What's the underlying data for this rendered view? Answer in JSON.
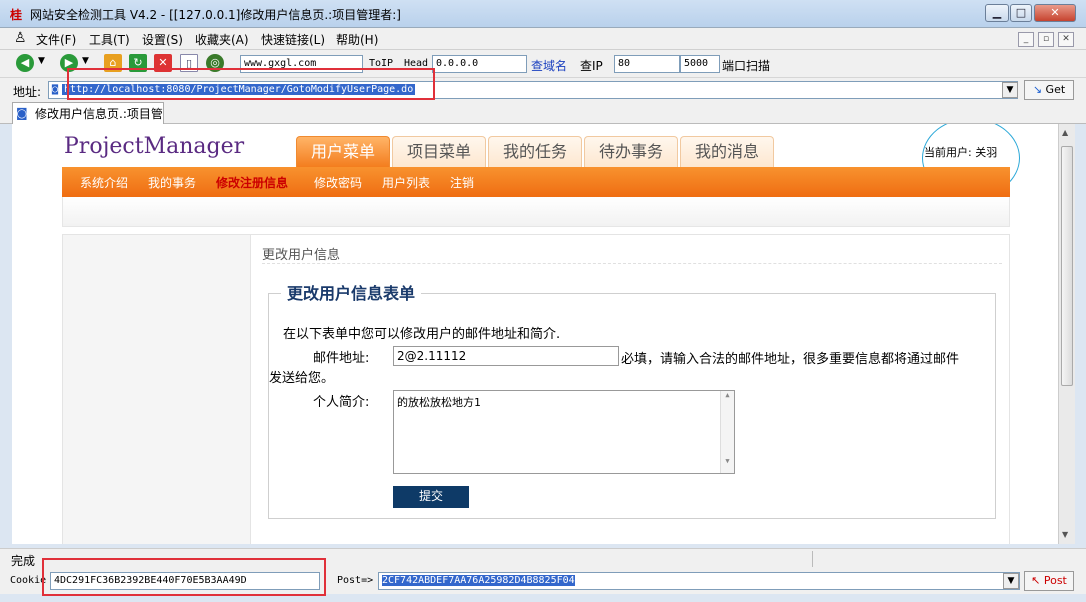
{
  "window": {
    "app_icon": "桂",
    "title": "网站安全检测工具 V4.2 - [[127.0.0.1]修改用户信息页.:项目管理者:]"
  },
  "menu": {
    "items": [
      "文件(F)",
      "工具(T)",
      "设置(S)",
      "收藏夹(A)",
      "快速链接(L)",
      "帮助(H)"
    ]
  },
  "toolbar": {
    "domain": "www.gxgl.com",
    "toip_label": "ToIP",
    "head_label": "Head",
    "ip_value": "0.0.0.0",
    "lookup_domain": "查域名",
    "lookup_ip": "查IP",
    "port_start": "80",
    "port_end": "5000",
    "port_scan": "端口扫描"
  },
  "address": {
    "label": "地址:",
    "url": "http://localhost:8080/ProjectManager/GotoModifyUserPage.do",
    "go": "Get"
  },
  "tab": {
    "label": "修改用户信息页.:项目管"
  },
  "site": {
    "logo": "ProjectManager",
    "nav_tabs": [
      "用户菜单",
      "项目菜单",
      "我的任务",
      "待办事务",
      "我的消息"
    ],
    "current_user": "当前用户: 关羽",
    "sub_menu": [
      "系统介绍",
      "我的事务",
      "修改注册信息",
      "修改密码",
      "用户列表",
      "注销"
    ],
    "breadcrumb": "更改用户信息",
    "form_title": "更改用户信息表单",
    "intro": "在以下表单中您可以修改用户的邮件地址和简介.",
    "email_label": "邮件地址:",
    "email_value": "2@2.11112",
    "email_hint_1": "必填，请输入合法的邮件地址，很多重要信息都将通过邮件",
    "email_hint_2": "发送给您。",
    "bio_label": "个人简介:",
    "bio_value": "的放松放松地方1",
    "submit": "提交"
  },
  "status": {
    "text": "完成"
  },
  "bottom": {
    "cookie_label": "Cookie",
    "cookie_value": "4DC291FC36B2392BE440F70E5B3AA49D",
    "post_label": "Post=>",
    "post_value": "2CF742ABDEF7AA76A25982D4B8825F04",
    "post_button": "Post"
  },
  "colors": {
    "accent_orange": "#f37d1e",
    "submit_blue": "#0e3a67",
    "highlight_red": "#e0303a",
    "annotation_circle": "#2ba8d8"
  }
}
